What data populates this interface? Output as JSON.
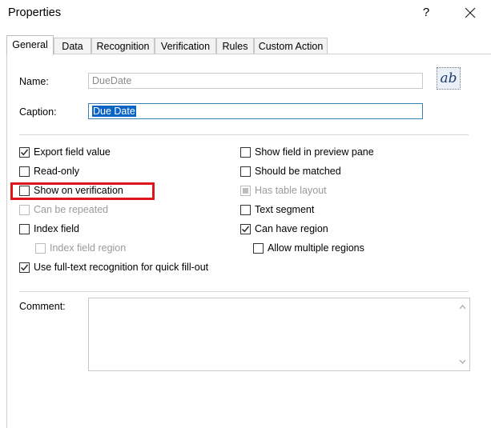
{
  "window": {
    "title": "Properties",
    "help_label": "?"
  },
  "tabs": [
    {
      "label": "General"
    },
    {
      "label": "Data"
    },
    {
      "label": "Recognition"
    },
    {
      "label": "Verification"
    },
    {
      "label": "Rules"
    },
    {
      "label": "Custom Action"
    }
  ],
  "fields": {
    "name_label": "Name:",
    "name_value": "DueDate",
    "caption_label": "Caption:",
    "caption_value": "Due Date",
    "ab_button": "ab",
    "comment_label": "Comment:",
    "comment_value": ""
  },
  "checkboxes": {
    "export_field_value": {
      "label": "Export field value",
      "checked": true,
      "enabled": true
    },
    "read_only": {
      "label": "Read-only",
      "checked": false,
      "enabled": true
    },
    "show_on_verification": {
      "label": "Show on verification",
      "checked": false,
      "enabled": true
    },
    "can_be_repeated": {
      "label": "Can be repeated",
      "checked": false,
      "enabled": false
    },
    "index_field": {
      "label": "Index field",
      "checked": false,
      "enabled": true
    },
    "index_field_region": {
      "label": "Index field region",
      "checked": false,
      "enabled": false
    },
    "use_full_text": {
      "label": "Use full-text recognition for quick fill-out",
      "checked": true,
      "enabled": true
    },
    "show_in_preview": {
      "label": "Show field in preview pane",
      "checked": false,
      "enabled": true
    },
    "should_be_matched": {
      "label": "Should be matched",
      "checked": false,
      "enabled": true
    },
    "has_table_layout": {
      "label": "Has table layout",
      "checked": "indeterminate",
      "enabled": false
    },
    "text_segment": {
      "label": "Text segment",
      "checked": false,
      "enabled": true
    },
    "can_have_region": {
      "label": "Can have region",
      "checked": true,
      "enabled": true
    },
    "allow_multiple_regions": {
      "label": "Allow multiple regions",
      "checked": false,
      "enabled": true
    }
  },
  "colors": {
    "highlight_border": "#e0141b",
    "selection_bg": "#0a64c8",
    "focus_border": "#3c7fb1"
  }
}
